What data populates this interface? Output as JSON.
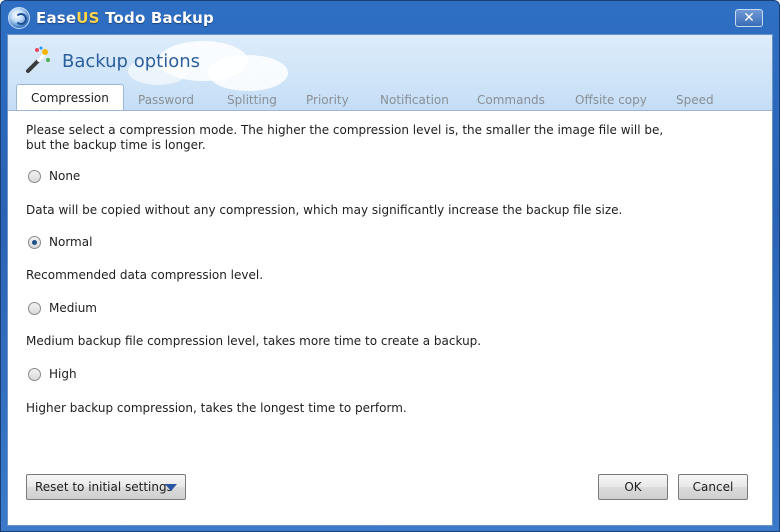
{
  "window": {
    "title_prefix": "Ease",
    "title_brand": "US",
    "title_suffix": " Todo Backup",
    "close_label": "✕"
  },
  "header": {
    "title": "Backup options"
  },
  "tabs": [
    {
      "label": "Compression",
      "active": true
    },
    {
      "label": "Password"
    },
    {
      "label": "Splitting"
    },
    {
      "label": "Priority"
    },
    {
      "label": "Notification"
    },
    {
      "label": "Commands"
    },
    {
      "label": "Offsite copy"
    },
    {
      "label": "Speed"
    }
  ],
  "content": {
    "intro_line1": "Please select a compression mode. The higher the compression level is, the smaller the image file will be,",
    "intro_line2": "but the backup time is longer.",
    "options": [
      {
        "label": "None",
        "desc": "Data will be copied without any compression, which may significantly increase the backup file size.",
        "checked": false
      },
      {
        "label": "Normal",
        "desc": "Recommended data compression level.",
        "checked": true
      },
      {
        "label": "Medium",
        "desc": "Medium backup file compression level, takes more time to create a backup.",
        "checked": false
      },
      {
        "label": "High",
        "desc": "Higher backup compression, takes the longest time to perform.",
        "checked": false
      }
    ]
  },
  "footer": {
    "reset_label": "Reset to initial settings",
    "ok_label": "OK",
    "cancel_label": "Cancel"
  }
}
